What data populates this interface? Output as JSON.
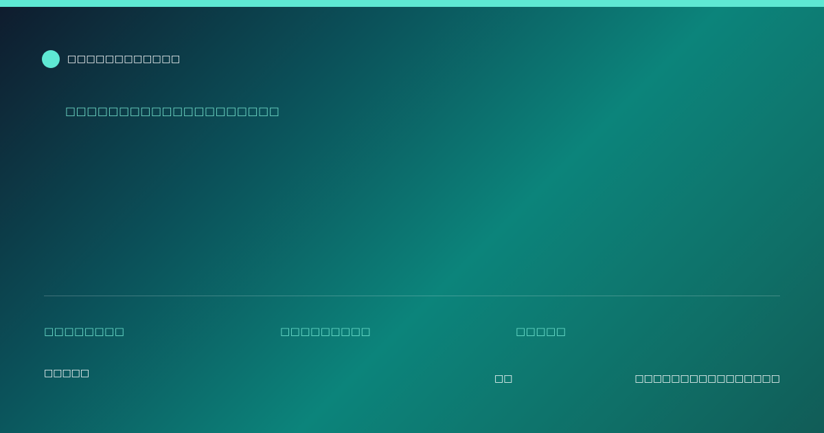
{
  "brand": {
    "name": "□□□□□□□□□□□□"
  },
  "hero": {
    "subtitle": "□□□□□□□□□□□□□□□□□□□□"
  },
  "stats": [
    {
      "label": "□□□□□□□□"
    },
    {
      "label": "□□□□□□□□□"
    },
    {
      "label": "□□□□□"
    }
  ],
  "footer": {
    "left": "□□□□□",
    "middle": "□□",
    "right": "□□□□□□□□□□□□□□□□"
  },
  "colors": {
    "accent": "#5ee8d3",
    "stat_text": "#6fe3cf",
    "background_start": "#0f1b2d",
    "background_mid": "#0c847b",
    "background_end": "#115c57"
  }
}
